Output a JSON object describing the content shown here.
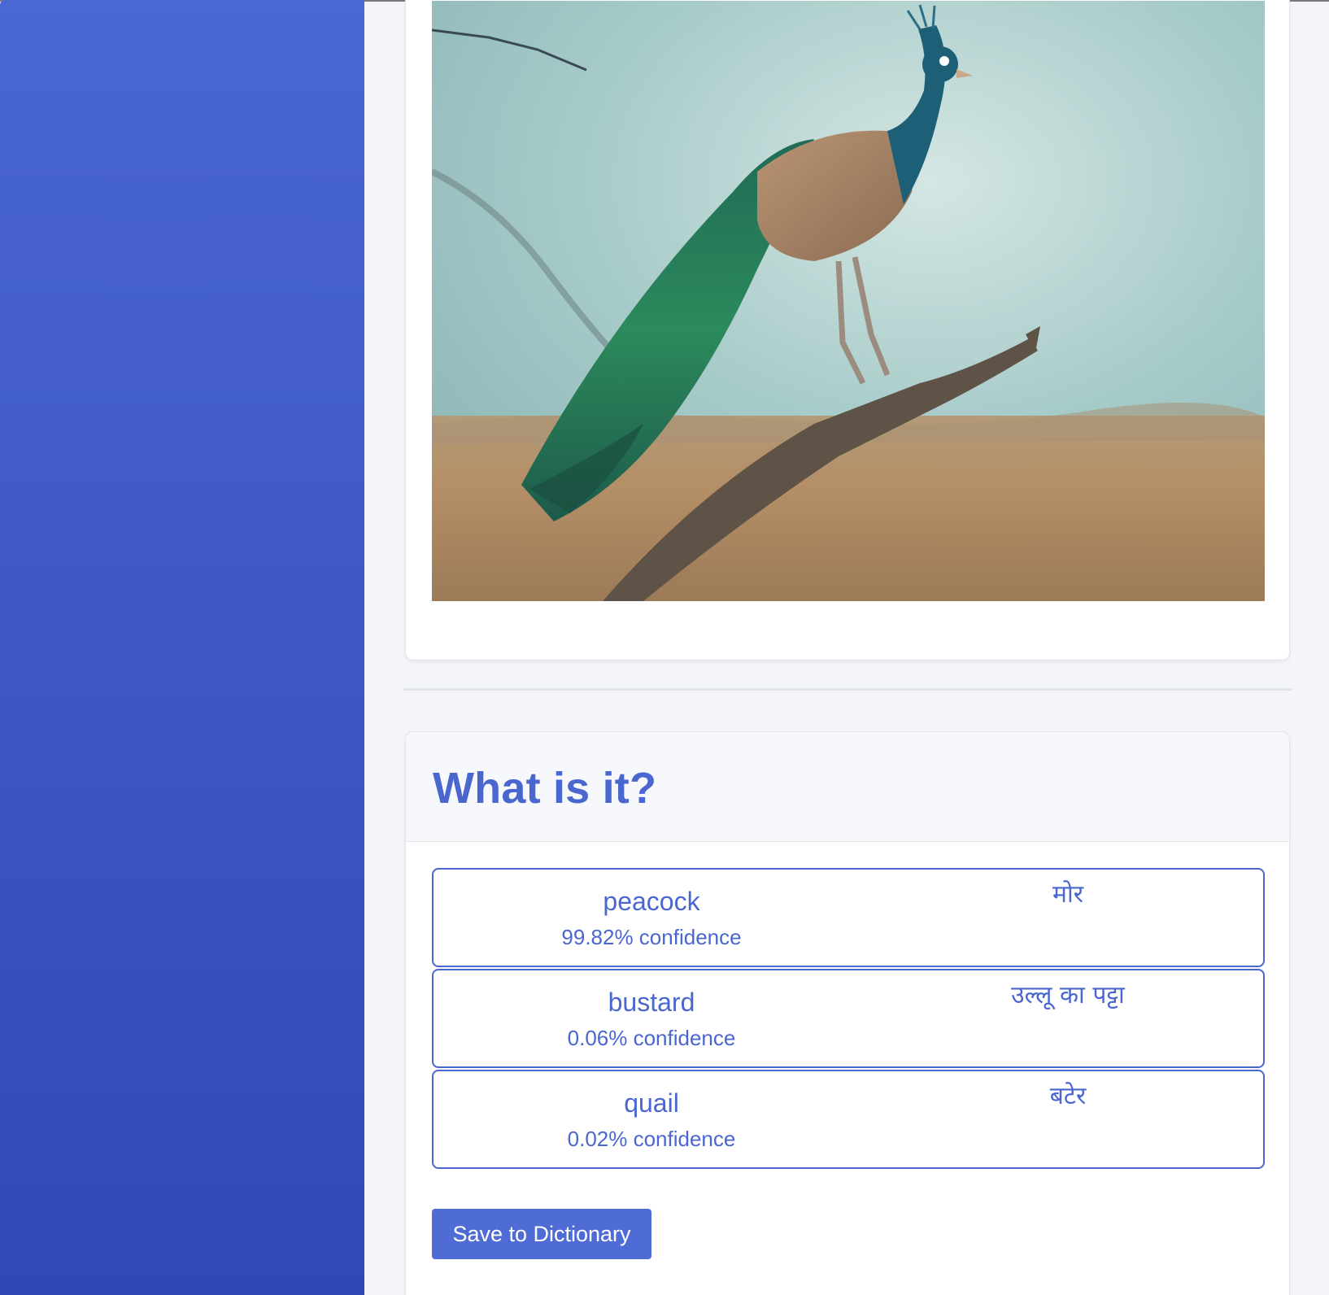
{
  "result": {
    "title": "What is it?",
    "predictions": [
      {
        "label": "peacock",
        "confidence": "99.82% confidence",
        "translation": "मोर"
      },
      {
        "label": "bustard",
        "confidence": "0.06% confidence",
        "translation": "उल्लू का पट्टा"
      },
      {
        "label": "quail",
        "confidence": "0.02% confidence",
        "translation": "बटेर"
      }
    ],
    "save_label": "Save to Dictionary"
  },
  "colors": {
    "accent": "#4a66cf",
    "sidebar_top": "#4a67d3",
    "sidebar_bottom": "#2f48b8",
    "page_bg": "#f4f5f9"
  },
  "icons": {
    "uploaded_image": "peacock-photo"
  }
}
